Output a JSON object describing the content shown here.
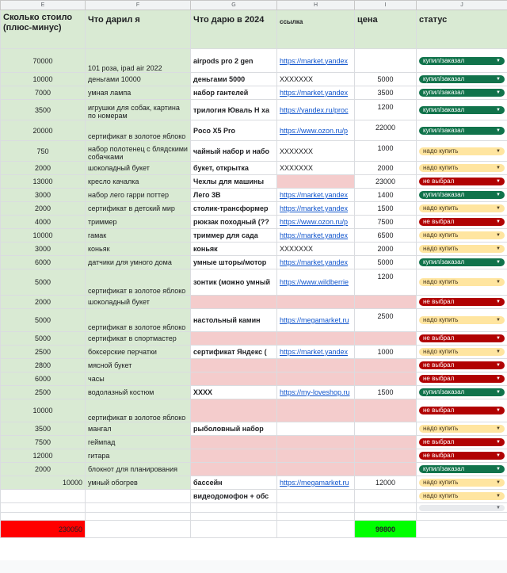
{
  "columns": [
    "E",
    "F",
    "G",
    "H",
    "I",
    "J"
  ],
  "headers": {
    "cost": "Сколько стоило (плюс-минус)",
    "gave": "Что дарил я",
    "give2024": "Что дарю в 2024",
    "link": "ссылка",
    "price": "цена",
    "status": "статус"
  },
  "rows": [
    {
      "cost": "70000",
      "gave": "101 роза, ipad air 2022",
      "give": "airpods pro 2 gen",
      "link": "https://market.yandex",
      "price": "",
      "status": "купил/заказал",
      "s": "done"
    },
    {
      "cost": "10000",
      "gave": "деньгами 10000",
      "give": "деньгами 5000",
      "link": "XXXXXXX",
      "price": "5000",
      "status": "купил/заказал",
      "s": "done"
    },
    {
      "cost": "7000",
      "gave": "умная лампа",
      "give": "набор гантелей",
      "link": "https://market.yandex",
      "price": "3500",
      "status": "купил/заказал",
      "s": "done"
    },
    {
      "cost": "3500",
      "gave": "игрушки для собак, картина по номерам",
      "give": "трилогия Юваль Н ха",
      "link": "https://yandex.ru/proc",
      "price": "1200",
      "status": "купил/заказал",
      "s": "done"
    },
    {
      "cost": "20000",
      "gave": "сертификат в золотое яблоко",
      "give": "Poco X5 Pro",
      "link": "https://www.ozon.ru/p",
      "price": "22000",
      "status": "купил/заказал",
      "s": "done"
    },
    {
      "cost": "750",
      "gave": "набор полотенец с блядскими собачками",
      "give": "чайный набор и набо",
      "link": "XXXXXXX",
      "price": "1000",
      "status": "надо купить",
      "s": "buy"
    },
    {
      "cost": "2000",
      "gave": "шоколадный букет",
      "give": "букет, открытка",
      "link": "XXXXXXX",
      "price": "2000",
      "status": "надо купить",
      "s": "buy"
    },
    {
      "cost": "13000",
      "gave": "кресло качалка",
      "give": "Чехлы для машины",
      "link": "",
      "price": "23000",
      "status": "не выбрал",
      "s": "none"
    },
    {
      "cost": "3000",
      "gave": "набор лего гарри поттер",
      "give": "Лего 3В",
      "link": "https://market.yandex",
      "price": "1400",
      "status": "купил/заказал",
      "s": "done"
    },
    {
      "cost": "2000",
      "gave": "сертификат в детский мир",
      "give": "столик-трансформер",
      "link": "https://market.yandex",
      "price": "1500",
      "status": "надо купить",
      "s": "buy"
    },
    {
      "cost": "4000",
      "gave": "триммер",
      "give": "рюкзак походный (??",
      "link": "https://www.ozon.ru/p",
      "price": "7500",
      "status": "не выбрал",
      "s": "none"
    },
    {
      "cost": "10000",
      "gave": "гамак",
      "give": "триммер для сада",
      "link": "https://market.yandex",
      "price": "6500",
      "status": "надо купить",
      "s": "buy"
    },
    {
      "cost": "3000",
      "gave": "коньяк",
      "give": "коньяк",
      "link": "XXXXXXX",
      "price": "2000",
      "status": "надо купить",
      "s": "buy"
    },
    {
      "cost": "6000",
      "gave": "датчики для умного дома",
      "give": "умные шторы/мотор",
      "link": "https://market.yandex",
      "price": "5000",
      "status": "купил/заказал",
      "s": "done"
    },
    {
      "cost": "5000",
      "gave": "сертификат в золотое яблоко",
      "give": "зонтик (можно умный",
      "link": "https://www.wildberrie",
      "price": "1200",
      "status": "надо купить",
      "s": "buy"
    },
    {
      "cost": "2000",
      "gave": "шоколадный букет",
      "give": "",
      "link": "",
      "price": "",
      "status": "не выбрал",
      "s": "none"
    },
    {
      "cost": "5000",
      "gave": "сертификат в золотое яблоко",
      "give": "настольный камин",
      "link": "https://megamarket.ru",
      "price": "2500",
      "status": "надо купить",
      "s": "buy"
    },
    {
      "cost": "5000",
      "gave": "сертификат в спортмастер",
      "give": "",
      "link": "",
      "price": "",
      "status": "не выбрал",
      "s": "none"
    },
    {
      "cost": "2500",
      "gave": "боксерские перчатки",
      "give": "сертификат Яндекс (",
      "link": "https://market.yandex",
      "price": "1000",
      "status": "надо купить",
      "s": "buy"
    },
    {
      "cost": "2800",
      "gave": "мясной букет",
      "give": "",
      "link": "",
      "price": "",
      "status": "не выбрал",
      "s": "none"
    },
    {
      "cost": "6000",
      "gave": "часы",
      "give": "",
      "link": "",
      "price": "",
      "status": "не выбрал",
      "s": "none"
    },
    {
      "cost": "2500",
      "gave": "водолазный костюм",
      "give": "XXXX",
      "link": "https://my-loveshop.ru",
      "price": "1500",
      "status": "купил/заказал",
      "s": "done"
    },
    {
      "cost": "10000",
      "gave": "сертификат в золотое яблоко",
      "give": "",
      "link": "",
      "price": "",
      "status": "не выбрал",
      "s": "none"
    },
    {
      "cost": "3500",
      "gave": "мангал",
      "give": "рыболовный набор",
      "link": "",
      "price": "",
      "status": "надо купить",
      "s": "buy"
    },
    {
      "cost": "7500",
      "gave": "геймпад",
      "give": "",
      "link": "",
      "price": "",
      "status": "не выбрал",
      "s": "none"
    },
    {
      "cost": "12000",
      "gave": "гитара",
      "give": "",
      "link": "",
      "price": "",
      "status": "не выбрал",
      "s": "none"
    },
    {
      "cost": "2000",
      "gave": "блокнот для планирования",
      "give": "",
      "link": "",
      "price": "",
      "status": "купил/заказал",
      "s": "done"
    },
    {
      "cost": "10000",
      "gave": "умный обогрев",
      "give": "бассейн",
      "link": "https://megamarket.ru",
      "price": "12000",
      "status": "надо купить",
      "s": "buy"
    },
    {
      "cost": "",
      "gave": "",
      "give": "видеодомофон + обс",
      "link": "",
      "price": "",
      "status": "надо купить",
      "s": "buy"
    }
  ],
  "totals": {
    "cost": "230050",
    "price": "99800"
  },
  "icons": {
    "dropdown": "dropdown-arrow-icon"
  },
  "colors": {
    "header_green": "#d9ead3",
    "empty_pink": "#f4cccc",
    "status_done": "#11734b",
    "status_buy": "#ffe5a0",
    "status_none": "#b10202",
    "total_cost_red": "#ff0000",
    "total_price_green": "#00ff00"
  }
}
